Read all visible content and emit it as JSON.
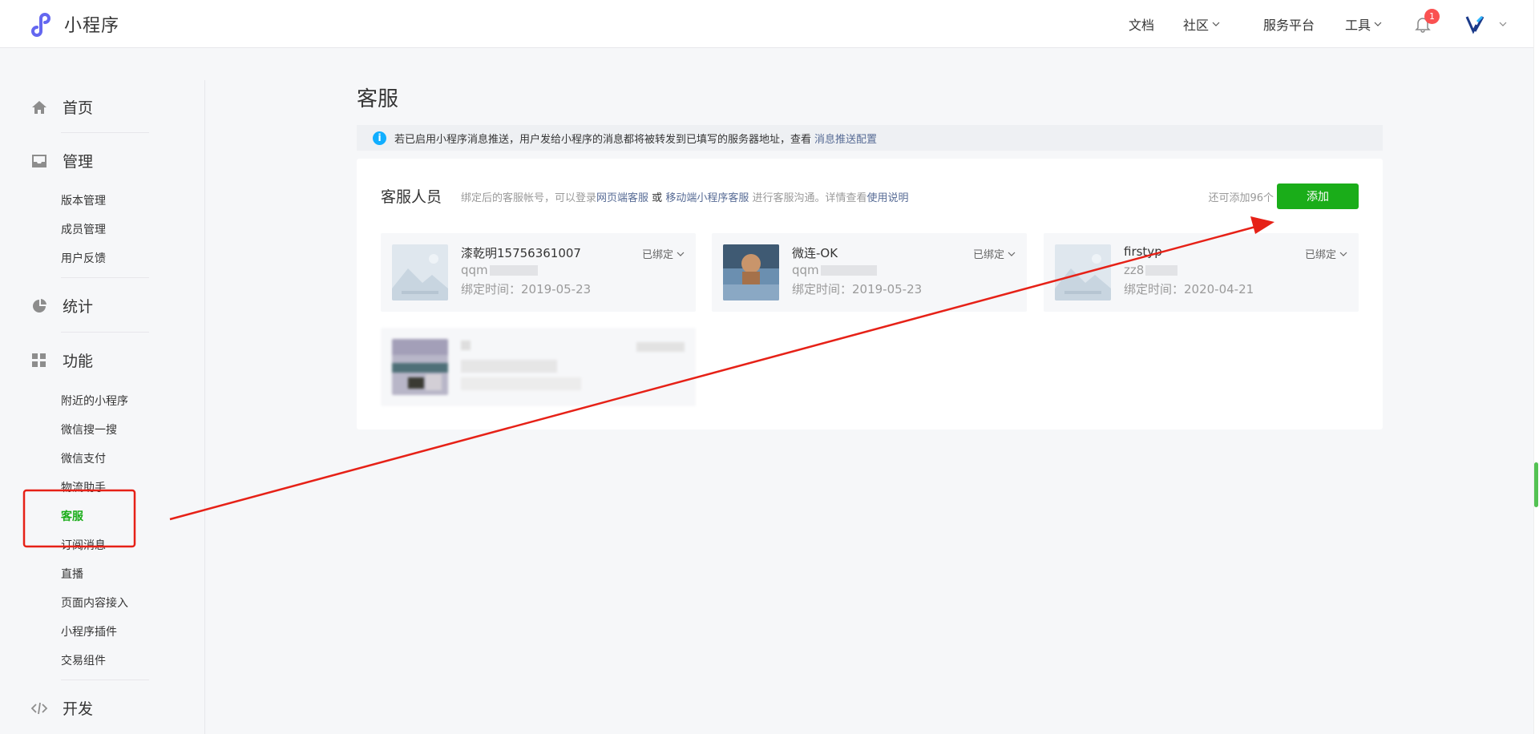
{
  "header": {
    "app_name": "小程序",
    "nav": [
      {
        "label": "文档",
        "has_dropdown": false
      },
      {
        "label": "社区",
        "has_dropdown": true
      },
      {
        "label": "服务平台",
        "has_dropdown": false
      },
      {
        "label": "工具",
        "has_dropdown": true
      }
    ],
    "notification_count": "1"
  },
  "sidebar": {
    "home": "首页",
    "manage": {
      "label": "管理",
      "items": [
        "版本管理",
        "成员管理",
        "用户反馈"
      ]
    },
    "stats": "统计",
    "features": {
      "label": "功能",
      "items": [
        "附近的小程序",
        "微信搜一搜",
        "微信支付",
        "物流助手",
        "客服",
        "订阅消息",
        "直播",
        "页面内容接入",
        "小程序插件",
        "交易组件"
      ]
    },
    "dev": "开发",
    "active_item": "客服"
  },
  "main": {
    "title": "客服",
    "notice": {
      "text": "若已启用小程序消息推送，用户发给小程序的消息都将被转发到已填写的服务器地址，查看",
      "link": "消息推送配置"
    },
    "panel": {
      "title": "客服人员",
      "desc_1": "绑定后的客服帐号，可以登录",
      "link_web": "网页端客服",
      "desc_or": "或",
      "link_mobile": "移动端小程序客服",
      "desc_2": "进行客服沟通。详情查看",
      "link_help": "使用说明",
      "remaining": "还可添加96个",
      "add_button": "添加"
    },
    "agents": [
      {
        "name": "漆乾明15756361007",
        "account": "qqm",
        "bind_time": "绑定时间：2019-05-23",
        "status": "已绑定",
        "avatar": "placeholder"
      },
      {
        "name": "微连-OK",
        "account": "qqm",
        "bind_time": "绑定时间：2019-05-23",
        "status": "已绑定",
        "avatar": "photo"
      },
      {
        "name": "firstyp",
        "account": "zz8",
        "bind_time": "绑定时间：2020-04-21",
        "status": "已绑定",
        "avatar": "placeholder"
      }
    ]
  },
  "colors": {
    "accent": "#1aad19",
    "link": "#576b95",
    "annotation": "#e62117",
    "info": "#10aeff"
  }
}
